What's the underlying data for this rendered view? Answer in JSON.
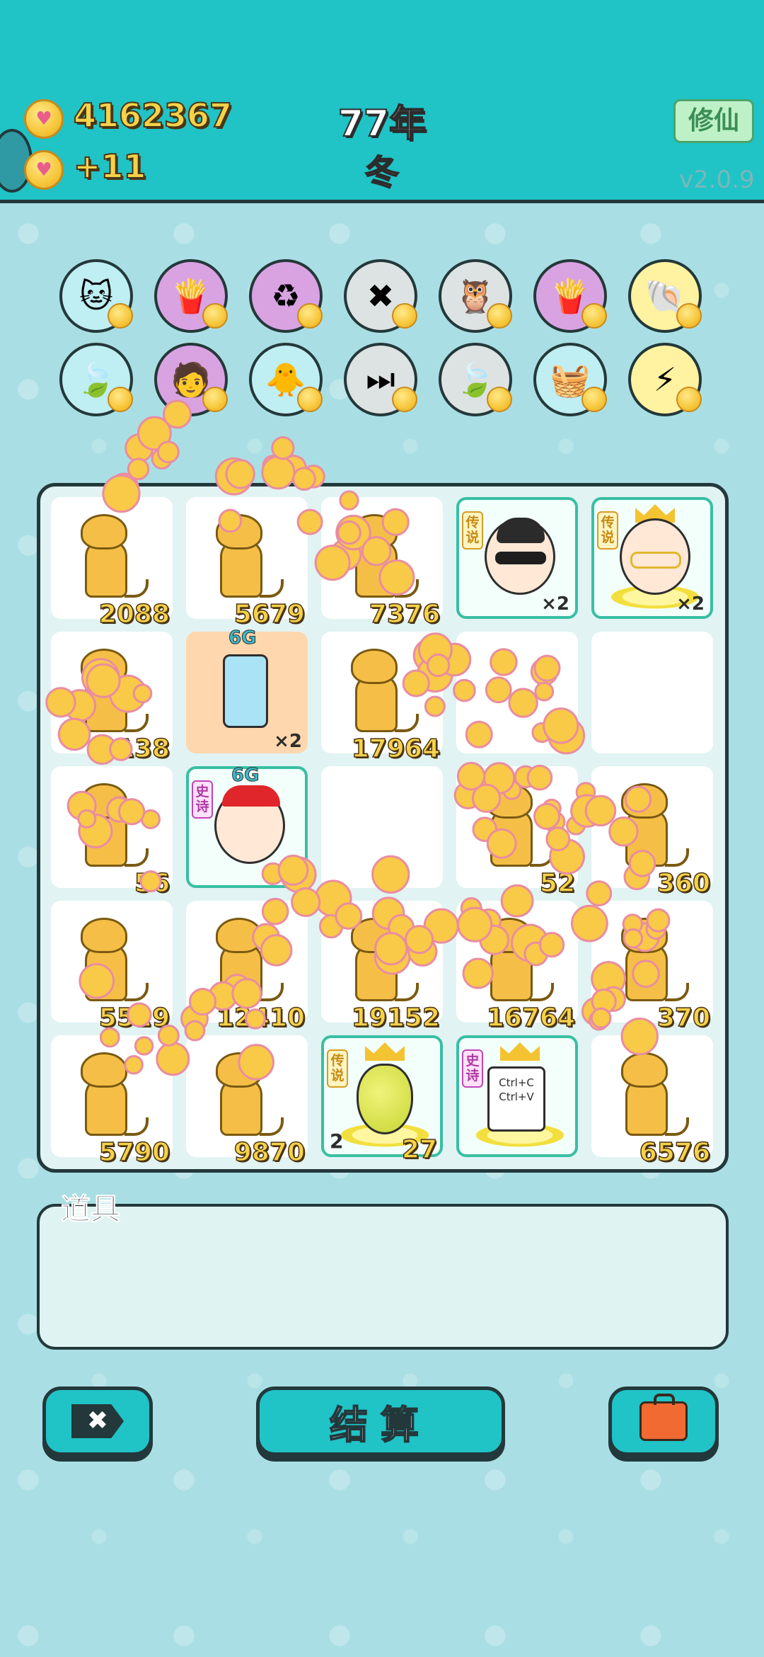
{
  "header": {
    "coins": "4162367",
    "income": "+11",
    "year": "77年",
    "season": "冬",
    "mode_button": "修仙",
    "version": "v2.0.9"
  },
  "items_row1": [
    {
      "name": "cat-item",
      "emoji": "🐱",
      "bg": "#bfeef3"
    },
    {
      "name": "fries-item",
      "emoji": "🍟",
      "bg": "#d9a3e2"
    },
    {
      "name": "recycle-item",
      "emoji": "♻",
      "bg": "#d9a3e2"
    },
    {
      "name": "remove-tag-item",
      "emoji": "✖",
      "bg": "#dde3e2"
    },
    {
      "name": "owl-twins-item",
      "emoji": "🦉",
      "bg": "#dde3e2"
    },
    {
      "name": "fries-item-2",
      "emoji": "🍟",
      "bg": "#d9a3e2"
    },
    {
      "name": "shell-item",
      "emoji": "🐚",
      "bg": "#fff2a0"
    }
  ],
  "items_row2": [
    {
      "name": "leaf-item",
      "emoji": "🍃",
      "bg": "#bfeef3"
    },
    {
      "name": "multiplier-man-item",
      "emoji": "🧑",
      "bg": "#d9a3e2"
    },
    {
      "name": "chick-egg-item",
      "emoji": "🐥",
      "bg": "#bfeef3"
    },
    {
      "name": "skip-item",
      "emoji": "⏭",
      "bg": "#dde3e2"
    },
    {
      "name": "leaf-item-2",
      "emoji": "🍃",
      "bg": "#dde3e2"
    },
    {
      "name": "fruit-basket-item",
      "emoji": "🧺",
      "bg": "#bfeef3"
    },
    {
      "name": "lightning-item",
      "emoji": "⚡",
      "bg": "#fff2a0"
    }
  ],
  "board": {
    "cells": [
      {
        "type": "cat",
        "value": "2088"
      },
      {
        "type": "cat",
        "value": "5679"
      },
      {
        "type": "cat",
        "value": "7376"
      },
      {
        "type": "face-sunglasses",
        "tag": "传说",
        "mult": "×2"
      },
      {
        "type": "face-crown",
        "tag": "传说",
        "mult": "×2"
      },
      {
        "type": "cat",
        "value": "138"
      },
      {
        "type": "fridge",
        "gen": "6G",
        "mult": "×2"
      },
      {
        "type": "cat",
        "value": "17964"
      },
      {
        "type": "empty"
      },
      {
        "type": "empty"
      },
      {
        "type": "cat",
        "value": "56"
      },
      {
        "type": "face-red-hat",
        "gen": "6G",
        "tag": "史诗"
      },
      {
        "type": "empty"
      },
      {
        "type": "cat",
        "value": "52"
      },
      {
        "type": "cat",
        "value": "360"
      },
      {
        "type": "cat",
        "value": "5529"
      },
      {
        "type": "cat",
        "value": "12410"
      },
      {
        "type": "cat",
        "value": "19152"
      },
      {
        "type": "cat",
        "value": "16764"
      },
      {
        "type": "cat",
        "value": "370"
      },
      {
        "type": "cat",
        "value": "5790"
      },
      {
        "type": "cat",
        "value": "9870"
      },
      {
        "type": "pear",
        "tag": "传说",
        "left_num": "2",
        "value": "27"
      },
      {
        "type": "ctrlcv",
        "tag": "史诗",
        "line1": "Ctrl+C",
        "line2": "Ctrl+V"
      },
      {
        "type": "cat",
        "value": "6576"
      }
    ]
  },
  "props": {
    "label": "道具"
  },
  "buttons": {
    "settle": "结算"
  }
}
